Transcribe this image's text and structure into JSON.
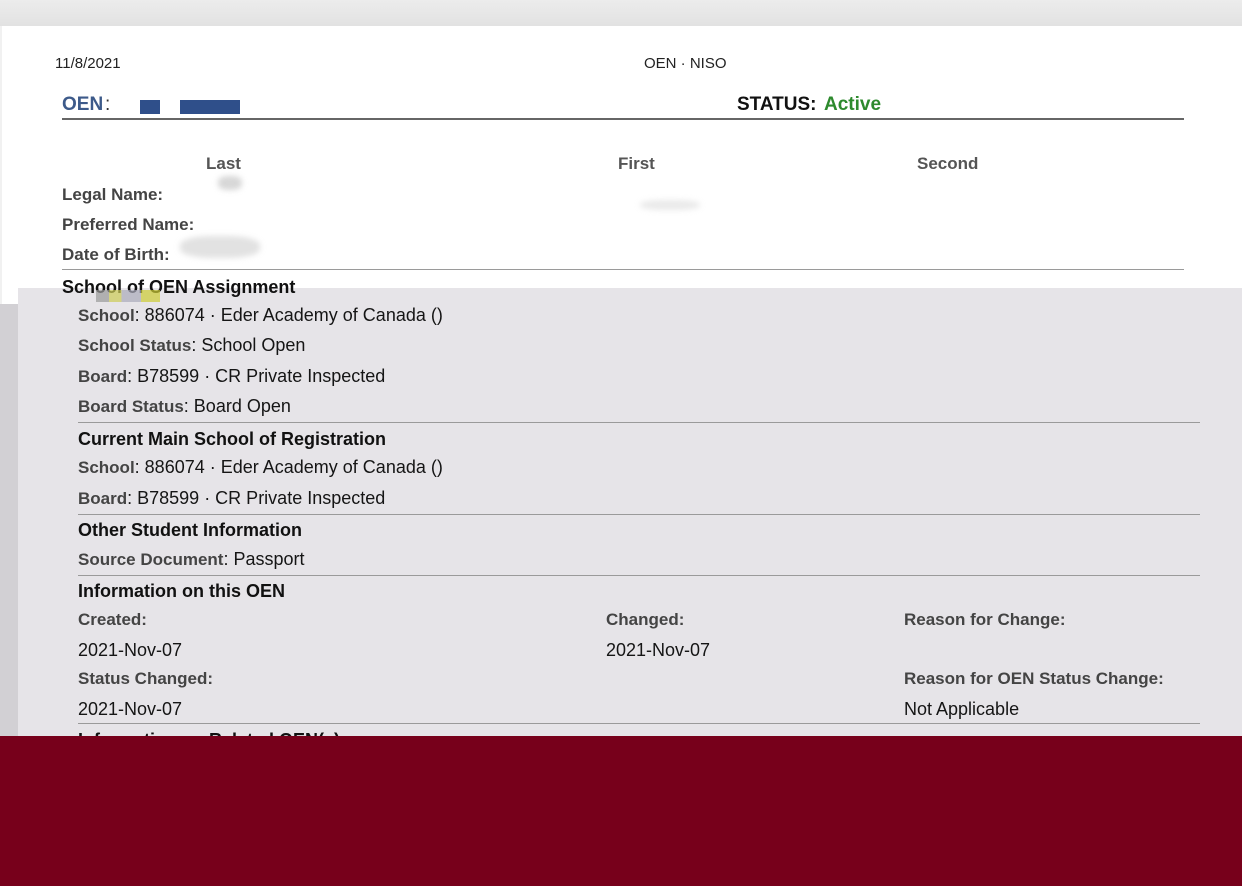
{
  "print_header": {
    "date": "11/8/2021",
    "title": "OEN · NISO"
  },
  "summary": {
    "oen_label": "OEN",
    "oen_colon": ":",
    "status_label": "STATUS:",
    "status_value": "Active"
  },
  "columns": {
    "last": "Last",
    "first": "First",
    "second": "Second"
  },
  "fields": {
    "legal_name": "Legal Name:",
    "preferred_name": "Preferred Name:",
    "date_of_birth": "Date of Birth:"
  },
  "school_of_assignment": {
    "title": "School of OEN Assignment",
    "school_label": "School",
    "school_value": ": 886074 · Eder Academy of Canada ()",
    "school_status_label": "School Status",
    "school_status_value": ": School Open",
    "board_label": "Board",
    "board_value": ": B78599 · CR Private Inspected",
    "board_status_label": "Board Status",
    "board_status_value": ": Board Open"
  },
  "main_school": {
    "title": "Current Main School of Registration",
    "school_label": "School",
    "school_value": ": 886074 · Eder Academy of Canada ()",
    "board_label": "Board",
    "board_value": ": B78599 · CR Private Inspected"
  },
  "other_info": {
    "title": "Other Student Information",
    "source_label": "Source Document",
    "source_value": ": Passport"
  },
  "oen_info": {
    "title": "Information on this OEN",
    "created_label": "Created:",
    "created_value": "2021-Nov-07",
    "changed_label": "Changed:",
    "changed_value": "2021-Nov-07",
    "reason_label": "Reason for Change:",
    "status_changed_label": "Status Changed:",
    "status_changed_value": "2021-Nov-07",
    "reason_status_label": "Reason for OEN Status Change:",
    "reason_status_value": "Not Applicable"
  },
  "related": {
    "title": "Information on Related OEN(s)"
  },
  "colors": {
    "oen_label": "#3d5a8a",
    "status_active": "#2d8a2d",
    "footer": "#77001b"
  }
}
